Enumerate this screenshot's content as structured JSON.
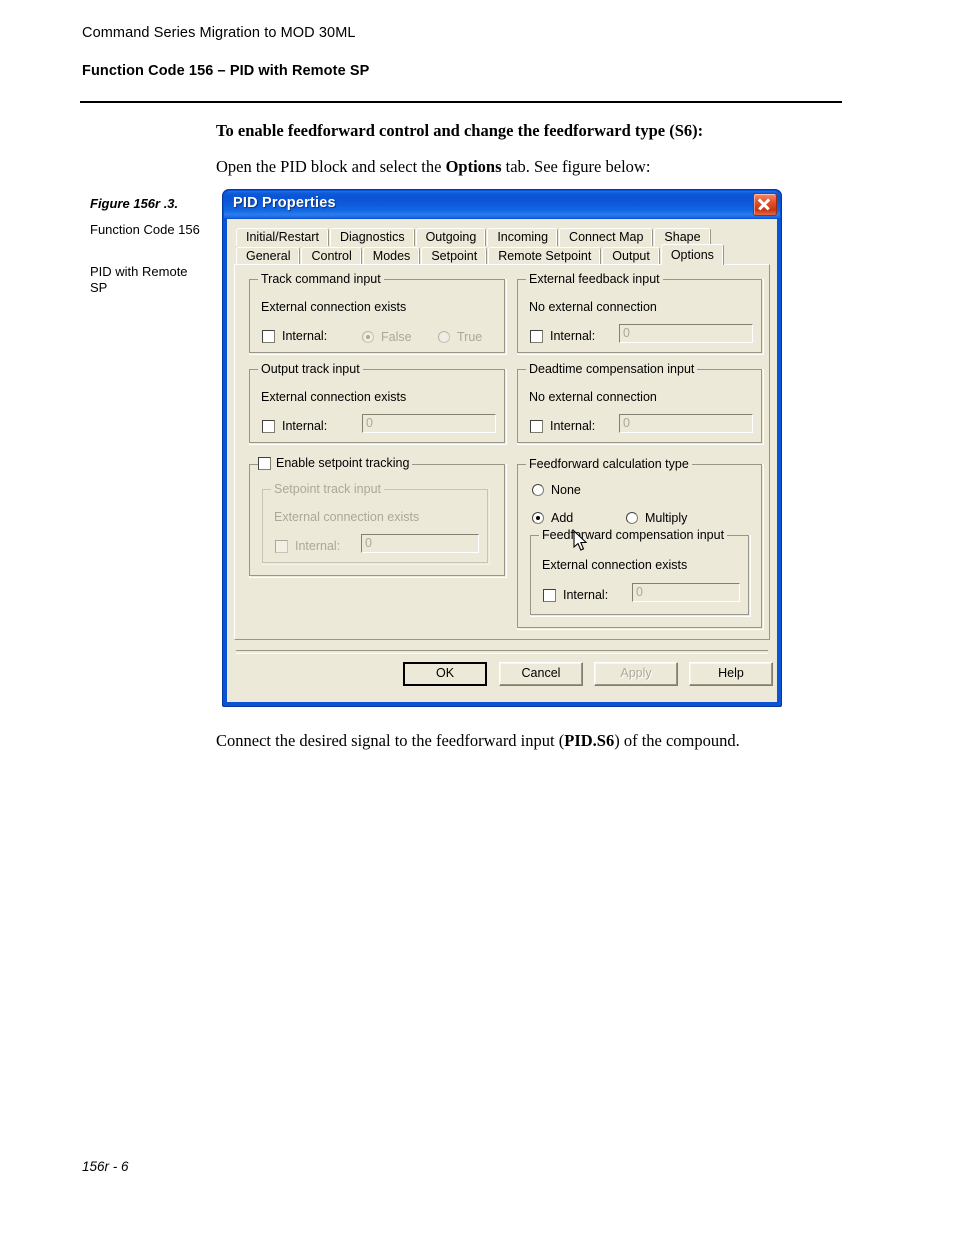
{
  "document": {
    "running_header": "Command Series Migration to MOD 30ML",
    "section_header": "Function Code 156 – PID with Remote SP",
    "instruction_heading": "To enable feedforward control and change the feedforward type (S6):",
    "instruction_line_prefix": "Open the PID block and select the ",
    "instruction_line_bold": "Options",
    "instruction_line_suffix": " tab. See figure below:",
    "closing_line_prefix": "Connect the desired signal to the feedforward input (",
    "closing_line_bold": "PID.S6",
    "closing_line_suffix": ") of the compound.",
    "figure_caption": "Figure 156r .3.",
    "figure_sub1": "Function Code 156",
    "figure_sub2": "PID with Remote SP",
    "page_number": "156r - 6"
  },
  "dialog": {
    "title": "PID Properties",
    "close_icon": "close-icon",
    "tabs_row1": [
      {
        "label": "Initial/Restart",
        "active": false
      },
      {
        "label": "Diagnostics",
        "active": false
      },
      {
        "label": "Outgoing",
        "active": false
      },
      {
        "label": "Incoming",
        "active": false
      },
      {
        "label": "Connect Map",
        "active": false
      },
      {
        "label": "Shape",
        "active": false
      }
    ],
    "tabs_row2": [
      {
        "label": "General",
        "active": false
      },
      {
        "label": "Control",
        "active": false
      },
      {
        "label": "Modes",
        "active": false
      },
      {
        "label": "Setpoint",
        "active": false
      },
      {
        "label": "Remote Setpoint",
        "active": false
      },
      {
        "label": "Output",
        "active": false
      },
      {
        "label": "Options",
        "active": true
      }
    ],
    "groups": {
      "track_command_input": {
        "legend": "Track command input",
        "status": "External connection exists",
        "internal_label": "Internal:",
        "internal_checked": false,
        "radio_false": "False",
        "radio_true": "True",
        "radio_selected": "False"
      },
      "external_feedback_input": {
        "legend": "External feedback input",
        "status": "No external connection",
        "internal_label": "Internal:",
        "internal_checked": false,
        "internal_value": "0"
      },
      "output_track_input": {
        "legend": "Output track input",
        "status": "External connection exists",
        "internal_label": "Internal:",
        "internal_checked": false,
        "internal_value": "0"
      },
      "deadtime_compensation_input": {
        "legend": "Deadtime compensation input",
        "status": "No external connection",
        "internal_label": "Internal:",
        "internal_checked": false,
        "internal_value": "0"
      },
      "enable_setpoint_tracking": {
        "legend": "Enable setpoint tracking",
        "checked": false,
        "inner_legend": "Setpoint track input",
        "status": "External connection exists",
        "internal_label": "Internal:",
        "internal_checked": false,
        "internal_value": "0"
      },
      "feedforward_calculation_type": {
        "legend": "Feedforward calculation type",
        "option_none": "None",
        "option_add": "Add",
        "option_multiply": "Multiply",
        "selected": "Add",
        "inner_legend": "Feedforward compensation input",
        "status": "External connection exists",
        "internal_label": "Internal:",
        "internal_checked": false,
        "internal_value": "0"
      }
    },
    "buttons": {
      "ok": "OK",
      "cancel": "Cancel",
      "apply": "Apply",
      "help": "Help"
    }
  },
  "colors": {
    "titlebar_blue": "#0a53d4",
    "dialog_face": "#ece9d8",
    "close_red": "#c83514",
    "disabled_text": "#aca899"
  }
}
